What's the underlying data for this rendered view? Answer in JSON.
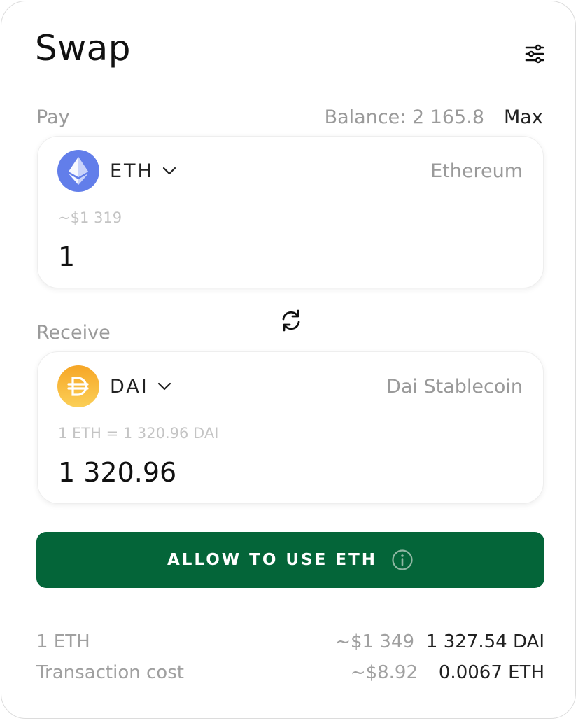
{
  "header": {
    "title": "Swap"
  },
  "pay": {
    "label": "Pay",
    "balance": "Balance: 2 165.8",
    "max_label": "Max",
    "token_symbol": "ETH",
    "token_name": "Ethereum",
    "usd_estimate": "~$1 319",
    "amount": "1",
    "logo_color": "#627eea"
  },
  "receive": {
    "label": "Receive",
    "token_symbol": "DAI",
    "token_name": "Dai Stablecoin",
    "rate": "1 ETH = 1 320.96 DAI",
    "amount": "1 320.96",
    "logo_color": "#f5ac37"
  },
  "action": {
    "allow_label": "ALLOW TO USE ETH",
    "button_color": "#046539"
  },
  "summary": {
    "rows": [
      {
        "label": "1 ETH",
        "usd": "~$1 349",
        "value": "1 327.54 DAI"
      },
      {
        "label": "Transaction cost",
        "usd": "~$8.92",
        "value": "0.0067 ETH"
      }
    ]
  },
  "icons": {
    "settings": "sliders-icon",
    "swap": "refresh-icon",
    "info": "info-icon",
    "chevron": "chevron-down-icon",
    "eth": "ethereum-logo",
    "dai": "dai-logo"
  }
}
